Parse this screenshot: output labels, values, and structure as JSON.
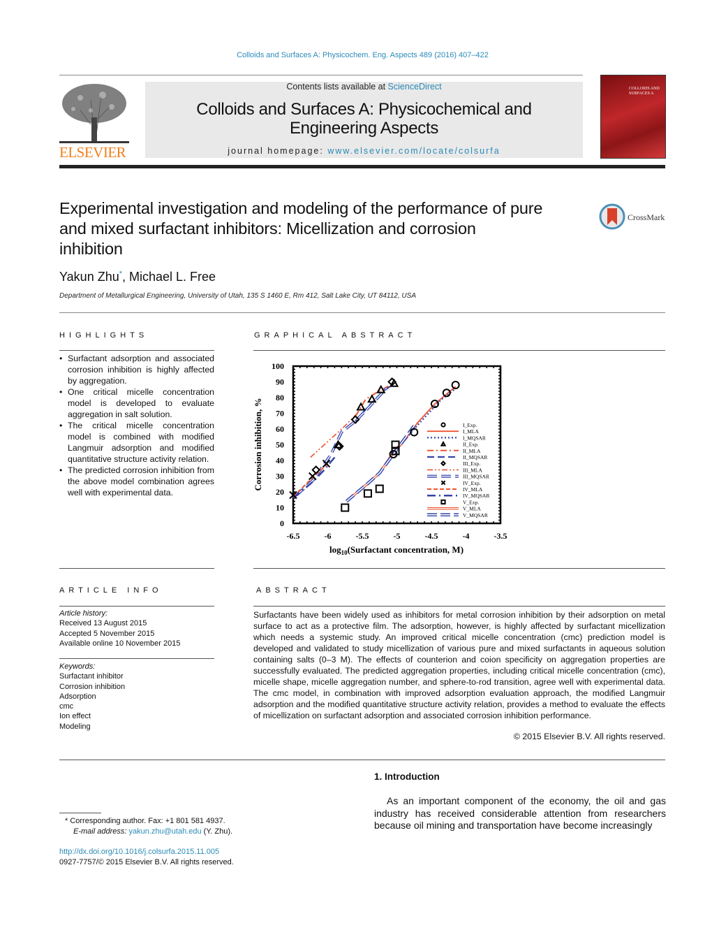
{
  "header": {
    "citation": "Colloids and Surfaces A: Physicochem. Eng. Aspects 489 (2016) 407–422",
    "contents_prefix": "Contents lists available at ",
    "contents_link": "ScienceDirect",
    "journal_title_line1": "Colloids and Surfaces A: Physicochemical and",
    "journal_title_line2": "Engineering Aspects",
    "homepage_prefix": "journal homepage: ",
    "homepage_link": "www.elsevier.com/locate/colsurfa",
    "publisher_logo": "ELSEVIER",
    "cover_text": "COLLOIDS AND SURFACES A",
    "accent_color": "#2a8ab8",
    "publisher_color": "#f07f1b"
  },
  "article": {
    "title_lines": [
      "Experimental investigation and modeling of the performance of pure",
      "and mixed surfactant inhibitors: Micellization and corrosion",
      "inhibition"
    ],
    "crossmark": "CrossMark",
    "author1": "Yakun Zhu",
    "author1_mark": "*",
    "author2": ", Michael L. Free",
    "affiliation": "Department of Metallurgical Engineering, University of Utah, 135 S 1460 E, Rm 412, Salt Lake City, UT 84112, USA"
  },
  "highlights": {
    "heading": "HIGHLIGHTS",
    "items": [
      "Surfactant adsorption and associated corrosion inhibition is highly affected by aggregation.",
      "One critical micelle concentration model is developed to evaluate aggregation in salt solution.",
      "The critical micelle concentration model is combined with modified Langmuir adsorption and modified quantitative structure activity relation.",
      "The predicted corrosion inhibition from the above model combination agrees well with experimental data."
    ]
  },
  "graphical_abstract": {
    "heading": "GRAPHICAL ABSTRACT"
  },
  "chart_data": {
    "type": "scatter",
    "xlabel_prefix": "log",
    "xlabel_sub": "10",
    "xlabel_rest": "(Surfactant concentration, M)",
    "ylabel": "Corrosion inhibition, %",
    "xlim": [
      -6.5,
      -3.5
    ],
    "ylim": [
      0,
      100
    ],
    "xticks": [
      "-6.5",
      "-6",
      "-5.5",
      "-5",
      "-4.5",
      "-4",
      "-3.5"
    ],
    "yticks": [
      "0",
      "10",
      "20",
      "30",
      "40",
      "50",
      "60",
      "70",
      "80",
      "90",
      "100"
    ],
    "legend_position": "right",
    "colors": {
      "MLA": "#ee5533",
      "MQSAR": "#3344aa",
      "Exp": "#000000"
    },
    "legend": [
      "I_Exp.",
      "I_MLA",
      "I_MQSAR",
      "II_Exp.",
      "II_MLA",
      "II_MQSAR",
      "III_Exp.",
      "III_MLA",
      "III_MQSAR",
      "IV_Exp.",
      "IV_MLA",
      "IV_MQSAR",
      "V_Exp.",
      "V_MLA",
      "V_MQSAR"
    ],
    "series": [
      {
        "name": "I",
        "marker": "circle",
        "exp": [
          [
            -5.05,
            44
          ],
          [
            -4.75,
            58
          ],
          [
            -4.45,
            76
          ],
          [
            -4.28,
            83
          ],
          [
            -4.15,
            88
          ]
        ],
        "mla": [
          [
            -5.1,
            42
          ],
          [
            -4.9,
            52
          ],
          [
            -4.7,
            64
          ],
          [
            -4.45,
            76
          ],
          [
            -4.15,
            87
          ]
        ],
        "mqsar": [
          [
            -5.05,
            44
          ],
          [
            -4.75,
            60
          ],
          [
            -4.5,
            72
          ],
          [
            -4.35,
            79
          ],
          [
            -4.17,
            85
          ]
        ]
      },
      {
        "name": "II",
        "marker": "triangle",
        "exp": [
          [
            -5.85,
            50
          ],
          [
            -5.52,
            74
          ],
          [
            -5.36,
            79
          ],
          [
            -5.23,
            85
          ],
          [
            -5.04,
            89
          ]
        ],
        "mla": [
          [
            -5.6,
            68
          ],
          [
            -5.45,
            79
          ],
          [
            -5.3,
            83
          ],
          [
            -5.05,
            89
          ]
        ],
        "mqsar": [
          [
            -5.6,
            65
          ],
          [
            -5.4,
            75
          ],
          [
            -5.2,
            84
          ],
          [
            -5.07,
            88
          ]
        ]
      },
      {
        "name": "III",
        "marker": "diamond",
        "exp": [
          [
            -6.17,
            34
          ],
          [
            -5.83,
            49
          ],
          [
            -5.6,
            66
          ],
          [
            -5.07,
            90
          ]
        ],
        "mla": [
          [
            -6.25,
            42
          ],
          [
            -6.0,
            52
          ],
          [
            -5.75,
            62
          ],
          [
            -5.55,
            71
          ]
        ],
        "mqsar": [
          [
            -6.45,
            18
          ],
          [
            -6.2,
            28
          ],
          [
            -5.95,
            44
          ],
          [
            -5.8,
            58
          ],
          [
            -5.6,
            65
          ],
          [
            -5.4,
            74
          ],
          [
            -5.15,
            86
          ]
        ]
      },
      {
        "name": "IV",
        "marker": "cross",
        "exp": [
          [
            -6.5,
            18
          ],
          [
            -6.22,
            30
          ],
          [
            -6.02,
            38
          ]
        ],
        "mla": [
          [
            -6.5,
            17
          ],
          [
            -6.22,
            29
          ],
          [
            -6.0,
            38
          ]
        ],
        "mqsar": [
          [
            -6.5,
            16
          ],
          [
            -6.2,
            27
          ],
          [
            -6.05,
            34
          ],
          [
            -5.9,
            42
          ]
        ]
      },
      {
        "name": "V",
        "marker": "square",
        "exp": [
          [
            -5.75,
            10
          ],
          [
            -5.42,
            19
          ],
          [
            -5.25,
            22
          ],
          [
            -5.02,
            50
          ],
          [
            -5.02,
            46
          ]
        ],
        "mla": [
          [
            -5.73,
            14
          ],
          [
            -5.43,
            25
          ],
          [
            -5.25,
            32
          ],
          [
            -5.05,
            45
          ],
          [
            -4.85,
            55
          ]
        ],
        "mqsar": [
          [
            -5.73,
            14
          ],
          [
            -5.43,
            25
          ],
          [
            -5.25,
            32
          ],
          [
            -5.05,
            44
          ],
          [
            -4.75,
            62
          ]
        ]
      }
    ]
  },
  "article_info": {
    "heading": "ARTICLE INFO",
    "history_label": "Article history:",
    "history": [
      "Received 13 August 2015",
      "Accepted 5 November 2015",
      "Available online 10 November 2015"
    ],
    "keywords_label": "Keywords:",
    "keywords": [
      "Surfactant inhibitor",
      "Corrosion inhibition",
      "Adsorption",
      "cmc",
      "Ion effect",
      "Modeling"
    ]
  },
  "abstract": {
    "heading": "ABSTRACT",
    "text": "Surfactants have been widely used as inhibitors for metal corrosion inhibition by their adsorption on metal surface to act as a protective film. The adsorption, however, is highly affected by surfactant micellization which needs a systemic study. An improved critical micelle concentration (cmc) prediction model is developed and validated to study micellization of various pure and mixed surfactants in aqueous solution containing salts (0–3 M). The effects of counterion and coion specificity on aggregation properties are successfully evaluated. The predicted aggregation properties, including critical micelle concentration (cmc), micelle shape, micelle aggregation number, and sphere-to-rod transition, agree well with experimental data. The cmc model, in combination with improved adsorption evaluation approach, the modified Langmuir adsorption and the modified quantitative structure activity relation, provides a method to evaluate the effects of micellization on surfactant adsorption and associated corrosion inhibition performance.",
    "copyright": "© 2015 Elsevier B.V. All rights reserved."
  },
  "introduction": {
    "heading": "1.  Introduction",
    "text": "As an important component of the economy, the oil and gas industry has received considerable attention from researchers because oil mining and transportation have become increasingly"
  },
  "footnote": {
    "mark": "*",
    "corresponding": " Corresponding author. Fax: +1 801 581 4937.",
    "email_label": "E-mail address: ",
    "email": "yakun.zhu@utah.edu",
    "email_suffix": " (Y. Zhu)."
  },
  "doi": {
    "link": "http://dx.doi.org/10.1016/j.colsurfa.2015.11.005",
    "issn": "0927-7757/© 2015 Elsevier B.V. All rights reserved."
  }
}
